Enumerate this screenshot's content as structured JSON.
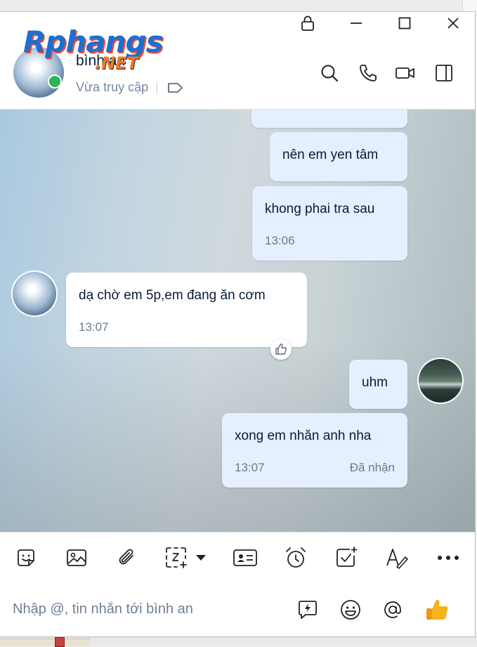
{
  "window": {
    "controls": {
      "lock_icon": "lock-icon",
      "minimize_icon": "minimize-icon",
      "maximize_icon": "maximize-icon",
      "close_icon": "close-icon"
    }
  },
  "watermark": {
    "line1": "Rphangs",
    "line2": ".NET"
  },
  "header": {
    "contact_name": "bình an",
    "status": "Vừa truy cập",
    "online_color": "#2bb45a",
    "icons": [
      "search-icon",
      "phone-icon",
      "video-call-icon",
      "sidebar-toggle-icon",
      "tag-icon"
    ]
  },
  "messages": [
    {
      "side": "mine",
      "text": "",
      "partial": true
    },
    {
      "side": "mine",
      "text": "nên em yen tâm"
    },
    {
      "side": "mine",
      "text": "khong phai tra sau",
      "time": "13:06"
    },
    {
      "side": "theirs",
      "text": "dạ chờ em 5p,em đang ăn cơm",
      "time": "13:07",
      "reaction": "thumbs-up-icon"
    },
    {
      "side": "mine",
      "text": "uhm"
    },
    {
      "side": "mine",
      "text": "xong em nhăn anh nha",
      "time": "13:07",
      "status": "Đã nhận"
    }
  ],
  "toolbar": {
    "icons": [
      "sticker-icon",
      "image-icon",
      "attachment-icon",
      "screenshot-icon",
      "chevron-down-icon",
      "contact-card-icon",
      "reminder-clock-icon",
      "task-check-icon",
      "text-format-icon",
      "more-icon"
    ]
  },
  "composer": {
    "placeholder": "Nhập @, tin nhắn tới bình an",
    "icons": [
      "quick-message-icon",
      "emoji-icon",
      "mention-icon",
      "like-icon"
    ]
  },
  "colors": {
    "accent": "#0068ff",
    "mine_bubble": "#e5efff",
    "text": "#081c36",
    "muted": "#7589a3",
    "like": "#f5b41e"
  }
}
